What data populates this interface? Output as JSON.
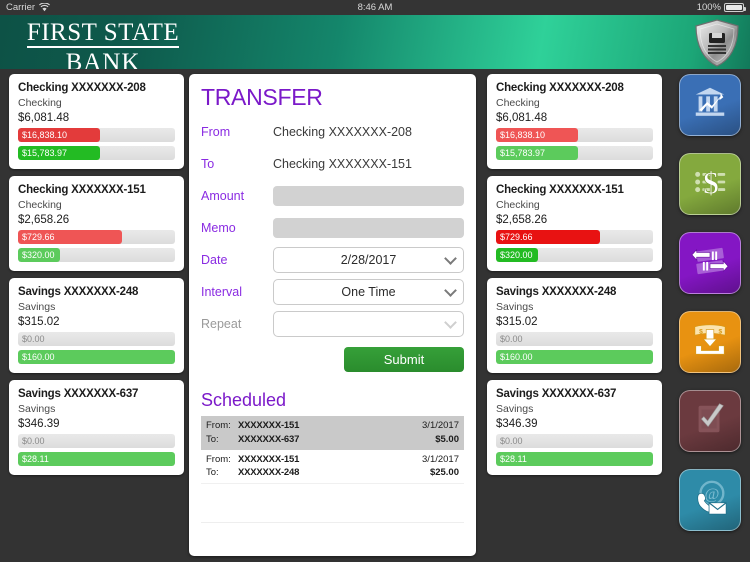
{
  "statusbar": {
    "carrier": "Carrier",
    "time": "8:46 AM",
    "battery": "100%",
    "wifi_icon": "wifi-icon",
    "battery_icon": "battery-icon"
  },
  "header": {
    "brand_line1": "FIRST STATE",
    "brand_line2": "BANK",
    "logo_icon": "shield-logo-icon"
  },
  "accounts": [
    {
      "title": "Checking XXXXXXX-208",
      "type": "Checking",
      "balance": "$6,081.48",
      "bar_red": "$16,838.10",
      "bar_green": "$15,783.97",
      "red_pct": 52,
      "green_pct": 52,
      "red_color": "#e33b3b",
      "green_color": "#23bb23"
    },
    {
      "title": "Checking XXXXXXX-151",
      "type": "Checking",
      "balance": "$2,658.26",
      "bar_red": "$729.66",
      "bar_green": "$320.00",
      "red_pct": 66,
      "green_pct": 27,
      "red_color": "#ef5555",
      "green_color": "#5ccb5c"
    },
    {
      "title": "Savings XXXXXXX-248",
      "type": "Savings",
      "balance": "$315.02",
      "bar_grey": "$0.00",
      "bar_green": "$160.00",
      "green_pct": 100,
      "green_color": "#5ccb5c"
    },
    {
      "title": "Savings XXXXXXX-637",
      "type": "Savings",
      "balance": "$346.39",
      "bar_grey": "$0.00",
      "bar_green": "$28.11",
      "green_pct": 100,
      "green_color": "#5ccb5c"
    }
  ],
  "accounts_right": [
    {
      "title": "Checking XXXXXXX-208",
      "type": "Checking",
      "balance": "$6,081.48",
      "bar_red": "$16,838.10",
      "bar_green": "$15,783.97",
      "red_pct": 52,
      "green_pct": 52,
      "red_color": "#ef5555",
      "green_color": "#5ccb5c"
    },
    {
      "title": "Checking XXXXXXX-151",
      "type": "Checking",
      "balance": "$2,658.26",
      "bar_red": "$729.66",
      "bar_green": "$320.00",
      "red_pct": 66,
      "green_pct": 27,
      "red_color": "#e81212",
      "green_color": "#23bb23"
    },
    {
      "title": "Savings XXXXXXX-248",
      "type": "Savings",
      "balance": "$315.02",
      "bar_grey": "$0.00",
      "bar_green": "$160.00",
      "green_pct": 100,
      "green_color": "#5ccb5c"
    },
    {
      "title": "Savings XXXXXXX-637",
      "type": "Savings",
      "balance": "$346.39",
      "bar_grey": "$0.00",
      "bar_green": "$28.11",
      "green_pct": 100,
      "green_color": "#5ccb5c"
    }
  ],
  "transfer": {
    "title": "TRANSFER",
    "from_label": "From",
    "from_value": "Checking XXXXXXX-208",
    "to_label": "To",
    "to_value": "Checking XXXXXXX-151",
    "amount_label": "Amount",
    "amount_value": "",
    "memo_label": "Memo",
    "memo_value": "",
    "date_label": "Date",
    "date_value": "2/28/2017",
    "interval_label": "Interval",
    "interval_value": "One Time",
    "repeat_label": "Repeat",
    "repeat_value": "",
    "submit_label": "Submit"
  },
  "scheduled": {
    "title": "Scheduled",
    "from_key": "From:",
    "to_key": "To:",
    "rows": [
      {
        "from": "XXXXXXX-151",
        "to": "XXXXXXX-637",
        "date": "3/1/2017",
        "amount": "$5.00",
        "highlighted": true
      },
      {
        "from": "XXXXXXX-151",
        "to": "XXXXXXX-248",
        "date": "3/1/2017",
        "amount": "$25.00",
        "highlighted": false
      }
    ]
  },
  "rail": [
    {
      "name": "accounts-overview-button",
      "icon": "bank-chart-icon",
      "color": "#3a6fb5"
    },
    {
      "name": "payments-button",
      "icon": "dollar-sign-icon",
      "color": "#84a93e"
    },
    {
      "name": "transfer-button",
      "icon": "transfer-arrows-icon",
      "color": "#8416c4"
    },
    {
      "name": "deposit-button",
      "icon": "deposit-inbox-icon",
      "color": "#e89211"
    },
    {
      "name": "approvals-button",
      "icon": "checkmark-clipboard-icon",
      "color": "#6b3a3f"
    },
    {
      "name": "contact-button",
      "icon": "phone-envelope-icon",
      "color": "#2e8ba8"
    }
  ]
}
